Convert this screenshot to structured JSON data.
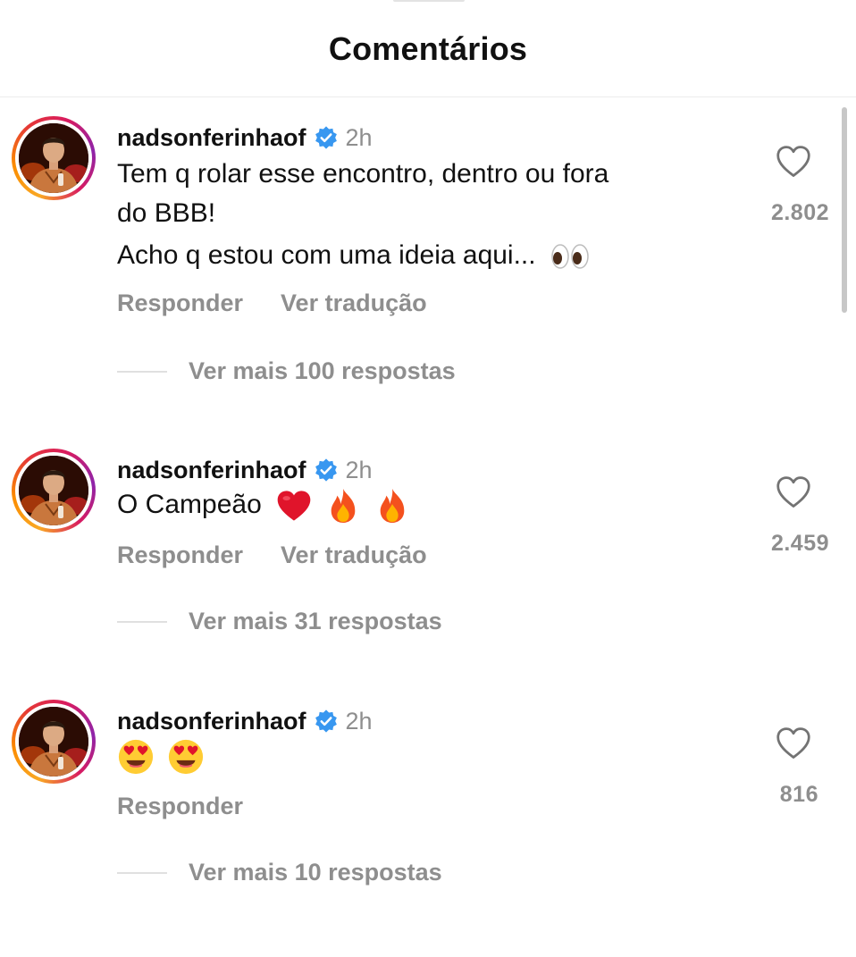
{
  "header": {
    "title": "Comentários"
  },
  "comments": [
    {
      "username": "nadsonferinhaof",
      "time": "2h",
      "lines": [
        "Tem q rolar esse encontro, dentro ou fora",
        "do BBB!",
        "Acho q estou com uma ideia aqui..."
      ],
      "emojis": [
        "eyes"
      ],
      "likes": "2.802",
      "reply": "Responder",
      "translate": "Ver tradução",
      "more_replies": "Ver mais 100 respostas"
    },
    {
      "username": "nadsonferinhaof",
      "time": "2h",
      "lines": [
        "O Campeão"
      ],
      "emojis": [
        "red-heart",
        "fire",
        "fire"
      ],
      "likes": "2.459",
      "reply": "Responder",
      "translate": "Ver tradução",
      "more_replies": "Ver mais 31 respostas"
    },
    {
      "username": "nadsonferinhaof",
      "time": "2h",
      "lines": [],
      "emojis": [
        "heart-eyes-face",
        "heart-eyes-face"
      ],
      "likes": "816",
      "reply": "Responder",
      "more_replies": "Ver mais 10 respostas"
    }
  ],
  "colors": {
    "verified": "#3897f0",
    "muted": "#8e8e8e",
    "text": "#111111"
  }
}
